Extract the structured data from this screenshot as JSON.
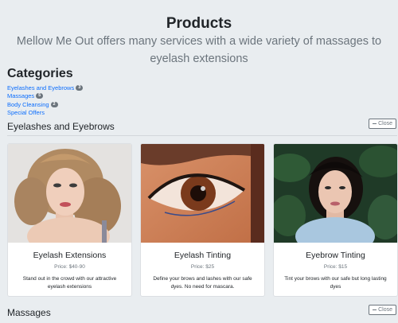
{
  "page": {
    "title": "Products",
    "subtitle": "Mellow Me Out offers many services with a wide variety of massages to eyelash extensions"
  },
  "categories": {
    "heading": "Categories",
    "items": [
      {
        "label": "Eyelashes and Eyebrows",
        "count": "3"
      },
      {
        "label": "Massages",
        "count": "5"
      },
      {
        "label": "Body Cleansing",
        "count": "2"
      },
      {
        "label": "Special Offers",
        "count": ""
      }
    ]
  },
  "sections": [
    {
      "title": "Eyelashes and Eyebrows",
      "close_label": "Close",
      "products": [
        {
          "name": "Eyelash Extensions",
          "price": "Price: $40-90",
          "description": "Stand out in the crowd with our attractive eyelash extensions",
          "image": "woman-portrait-curled-hair"
        },
        {
          "name": "Eyelash Tinting",
          "price": "Price: $25",
          "description": "Define your brows and lashes with our safe dyes. No need for mascara.",
          "image": "eye-closeup"
        },
        {
          "name": "Eyebrow Tinting",
          "price": "Price: $15",
          "description": "Tint your brows with our safe but long lasting dyes",
          "image": "woman-portrait-foliage"
        }
      ]
    },
    {
      "title": "Massages",
      "close_label": "Close"
    }
  ],
  "colors": {
    "background": "#e9edf0",
    "link": "#0d6efd",
    "badge": "#6c757d"
  }
}
